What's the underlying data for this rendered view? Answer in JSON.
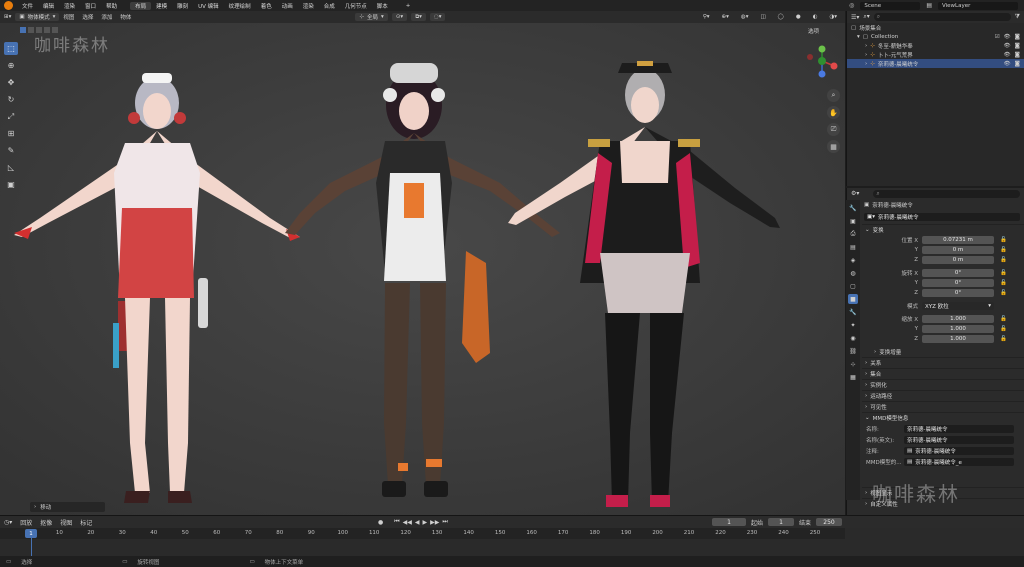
{
  "menubar": {
    "items": [
      "文件",
      "编辑",
      "渲染",
      "窗口",
      "帮助"
    ],
    "workspaces": [
      "布局",
      "建模",
      "雕刻",
      "UV 编辑",
      "纹理绘制",
      "着色",
      "动画",
      "渲染",
      "合成",
      "几何节点",
      "脚本"
    ],
    "active_workspace": "布局",
    "scene": "Scene",
    "view_layer": "ViewLayer"
  },
  "viewport_header": {
    "mode": "物体模式",
    "menus": [
      "视图",
      "选择",
      "添加",
      "物体"
    ],
    "transform_orientation": "全局",
    "options": "选项"
  },
  "watermarks": {
    "top_left": "咖啡森林",
    "bottom_right": "咖啡森林"
  },
  "operator_panel": {
    "label": "移动"
  },
  "outliner": {
    "rows": [
      {
        "label": "场景集合",
        "indent": 0
      },
      {
        "label": "Collection",
        "indent": 1
      },
      {
        "label": "冬至-薪魅华奉",
        "indent": 2
      },
      {
        "label": "卜卜-元气荒界",
        "indent": 2
      },
      {
        "label": "奈莉德-晨曦统令",
        "indent": 2,
        "selected": true
      }
    ]
  },
  "properties": {
    "object_name": "奈莉德-晨曦统令",
    "data_name": "奈莉德-晨曦统令",
    "transform_title": "变换",
    "location": {
      "label": "位置 X",
      "x": "0.07231 m",
      "y": "0 m",
      "z": "0 m"
    },
    "rotation": {
      "label": "旋转 X",
      "x": "0°",
      "y": "0°",
      "z": "0°"
    },
    "mode_label": "模式",
    "mode_value": "XYZ 欧拉",
    "scale": {
      "label": "缩放 X",
      "x": "1.000",
      "y": "1.000",
      "z": "1.000"
    },
    "delta_transform": "变换增量",
    "sections": [
      "关系",
      "集合",
      "实例化",
      "运动路径",
      "可见性"
    ],
    "mmd_section": "MMD模型信息",
    "mmd_fields": [
      {
        "label": "名称:",
        "value": "奈莉德-晨曦统令"
      },
      {
        "label": "名称(英文):",
        "value": "奈莉德-晨曦统令"
      },
      {
        "label": "注释:",
        "value": "奈莉德-晨曦统令"
      },
      {
        "label": "MMD模型的...",
        "value": "奈莉德-晨曦统令_e"
      }
    ],
    "footer_sections": [
      "视图显示",
      "自定义属性"
    ],
    "axis": [
      "X",
      "Y",
      "Z"
    ]
  },
  "timeline": {
    "menus": [
      "回放",
      "抠像",
      "视图",
      "标记"
    ],
    "current_frame": "1",
    "start_label": "起始",
    "start": "1",
    "end_label": "结束",
    "end": "250",
    "ticks": [
      "1",
      "10",
      "20",
      "30",
      "40",
      "50",
      "60",
      "70",
      "80",
      "90",
      "100",
      "110",
      "120",
      "130",
      "140",
      "150",
      "160",
      "170",
      "180",
      "190",
      "200",
      "210",
      "220",
      "230",
      "240",
      "250"
    ]
  },
  "statusbar": {
    "items": [
      "选择",
      "旋转视图",
      "物体上下文菜单"
    ]
  },
  "colors": {
    "accent": "#4772b3",
    "selected": "#334d80",
    "brand": "#e87d0d",
    "viewport": "#3d3d3d"
  }
}
